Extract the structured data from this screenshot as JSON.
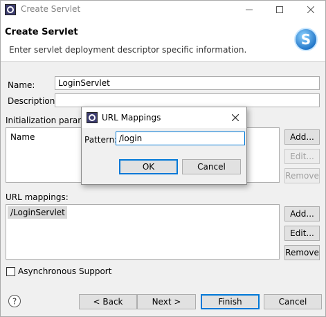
{
  "window": {
    "title": "Create Servlet",
    "controls": {
      "minimize": "minimize-icon",
      "maximize": "maximize-icon",
      "close": "close-icon"
    }
  },
  "banner": {
    "heading": "Create Servlet",
    "description": "Enter servlet deployment descriptor specific information."
  },
  "form": {
    "name_label": "Name:",
    "name_value": "LoginServlet",
    "description_label": "Description:",
    "description_value": "",
    "init_params_label": "Initialization parame",
    "init_params_column": "Name",
    "init_buttons": {
      "add": "Add...",
      "edit": "Edit...",
      "remove": "Remove"
    },
    "url_mappings_label": "URL mappings:",
    "url_mappings": [
      "/LoginServlet"
    ],
    "url_buttons": {
      "add": "Add...",
      "edit": "Edit...",
      "remove": "Remove"
    },
    "async_label": "Asynchronous Support",
    "async_checked": false
  },
  "footer": {
    "back": "< Back",
    "next": "Next >",
    "finish": "Finish",
    "cancel": "Cancel"
  },
  "dialog": {
    "title": "URL Mappings",
    "pattern_label": "Pattern:",
    "pattern_value": "/login",
    "ok": "OK",
    "cancel": "Cancel"
  },
  "colors": {
    "accent": "#0078d7",
    "selection": "#d9d9d9",
    "background": "#f0f0f0"
  }
}
